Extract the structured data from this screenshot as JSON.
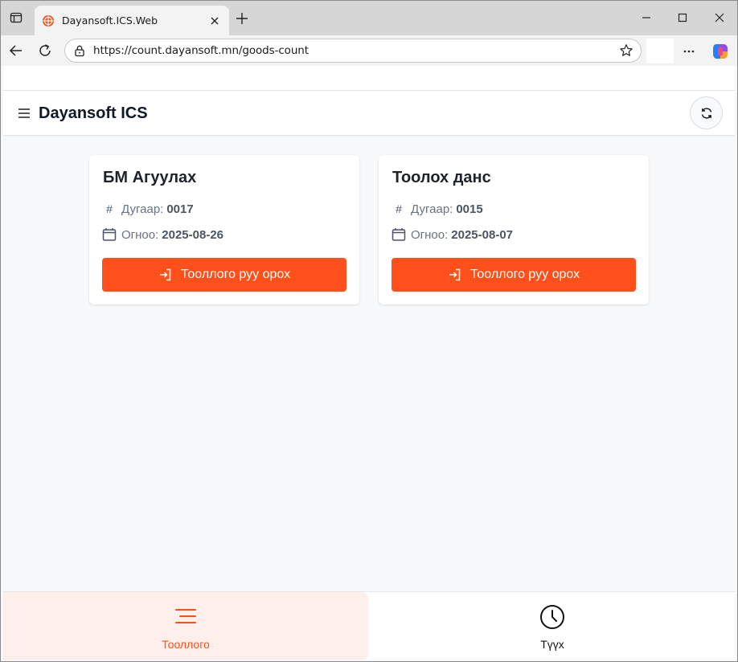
{
  "browser": {
    "tab_title": "Dayansoft.ICS.Web",
    "url": "https://count.dayansoft.mn/goods-count"
  },
  "app": {
    "title": "Dayansoft ICS"
  },
  "labels": {
    "number": "Дугаар:",
    "date": "Огноо:",
    "enter_button": "Тооллого руу орох"
  },
  "cards": [
    {
      "title": "БМ Агуулах",
      "number": "0017",
      "date": "2025-08-26"
    },
    {
      "title": "Тоолох данс",
      "number": "0015",
      "date": "2025-08-07"
    }
  ],
  "bottom_nav": {
    "items": [
      {
        "label": "Тооллого",
        "icon": "list-icon",
        "active": true
      },
      {
        "label": "Түүх",
        "icon": "clock-icon",
        "active": false
      }
    ]
  },
  "colors": {
    "accent": "#ff4f1a",
    "accent_bg": "#ffefea",
    "page_bg": "#f7f8fa"
  }
}
